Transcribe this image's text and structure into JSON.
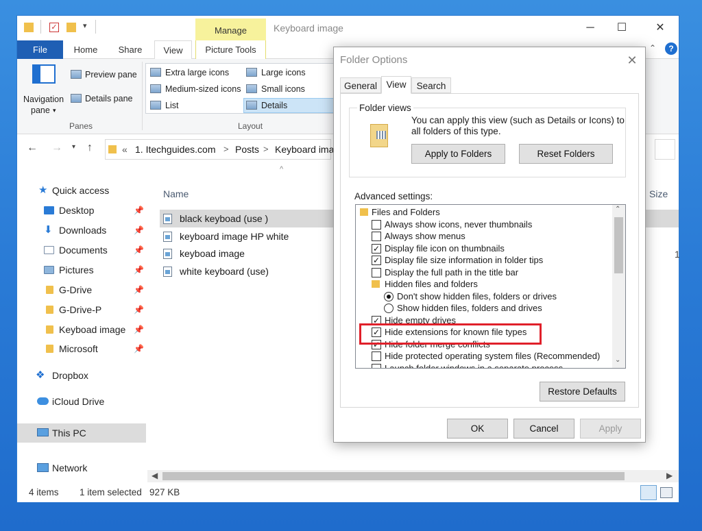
{
  "window": {
    "title": "Keyboard image",
    "manage_tab": "Manage",
    "controls": [
      "─",
      "☐",
      "✕"
    ]
  },
  "ribbon": {
    "tabs": {
      "file": "File",
      "home": "Home",
      "share": "Share",
      "view": "View",
      "picture_tools": "Picture Tools"
    },
    "panes": {
      "navigation_pane": "Navigation",
      "navigation_pane_2": "pane",
      "preview_pane": "Preview pane",
      "details_pane": "Details pane",
      "group_label": "Panes"
    },
    "layout": {
      "extra_large_icons": "Extra large icons",
      "large_icons": "Large icons",
      "medium_icons": "Medium-sized icons",
      "small_icons": "Small icons",
      "list": "List",
      "details": "Details",
      "group_label": "Layout"
    }
  },
  "address": {
    "prefix": "«",
    "crumbs": [
      "1. Itechguides.com",
      "Posts",
      "Keyboard ima"
    ],
    "separator": ">"
  },
  "nav_pane": {
    "quick_access": "Quick access",
    "items": [
      {
        "label": "Desktop",
        "pinned": true
      },
      {
        "label": "Downloads",
        "pinned": true
      },
      {
        "label": "Documents",
        "pinned": true
      },
      {
        "label": "Pictures",
        "pinned": true
      },
      {
        "label": "G-Drive",
        "pinned": true
      },
      {
        "label": "G-Drive-P",
        "pinned": true
      },
      {
        "label": "Keyboad image",
        "pinned": true
      },
      {
        "label": "Microsoft",
        "pinned": true
      }
    ],
    "dropbox": "Dropbox",
    "icloud": "iCloud Drive",
    "this_pc": "This PC",
    "network": "Network"
  },
  "file_list": {
    "col_name": "Name",
    "col_size": "Size",
    "files": [
      "black keyboad (use )",
      "keyboard image HP white",
      "keyboad image",
      "white keyboard (use)"
    ],
    "size_partial": "1"
  },
  "status": {
    "items": "4 items",
    "selected": "1 item selected",
    "size": "927 KB"
  },
  "dialog": {
    "title": "Folder Options",
    "tabs": [
      "General",
      "View",
      "Search"
    ],
    "folder_views_label": "Folder views",
    "folder_views_text": "You can apply this view (such as Details or Icons) to",
    "folder_views_text_2": "all folders of this type.",
    "apply_to_folders": "Apply to Folders",
    "reset_folders": "Reset Folders",
    "advanced_label": "Advanced settings:",
    "options": [
      {
        "type": "folder",
        "label": "Files and Folders"
      },
      {
        "type": "checkbox",
        "checked": false,
        "label": "Always show icons, never thumbnails"
      },
      {
        "type": "checkbox",
        "checked": false,
        "label": "Always show menus"
      },
      {
        "type": "checkbox",
        "checked": true,
        "label": "Display file icon on thumbnails"
      },
      {
        "type": "checkbox",
        "checked": true,
        "label": "Display file size information in folder tips"
      },
      {
        "type": "checkbox",
        "checked": false,
        "label": "Display the full path in the title bar"
      },
      {
        "type": "folder",
        "label": "Hidden files and folders"
      },
      {
        "type": "radio",
        "checked": true,
        "label": "Don't show hidden files, folders or drives"
      },
      {
        "type": "radio",
        "checked": false,
        "label": "Show hidden files, folders and drives"
      },
      {
        "type": "checkbox",
        "checked": true,
        "label": "Hide empty drives"
      },
      {
        "type": "checkbox",
        "checked": true,
        "label": "Hide extensions for known file types"
      },
      {
        "type": "checkbox",
        "checked": true,
        "label": "Hide folder merge conflicts"
      },
      {
        "type": "checkbox",
        "checked": false,
        "label": "Hide protected operating system files (Recommended)"
      },
      {
        "type": "checkbox",
        "checked": false,
        "label": "Launch folder windows in a separate process"
      }
    ],
    "restore_defaults": "Restore Defaults",
    "ok": "OK",
    "cancel": "Cancel",
    "apply": "Apply"
  },
  "colors": {
    "file_tab": "#1f5fb4",
    "manage_tab": "#f7f29c",
    "highlight": "#e0202a",
    "desktop": "#2a7bd6"
  }
}
